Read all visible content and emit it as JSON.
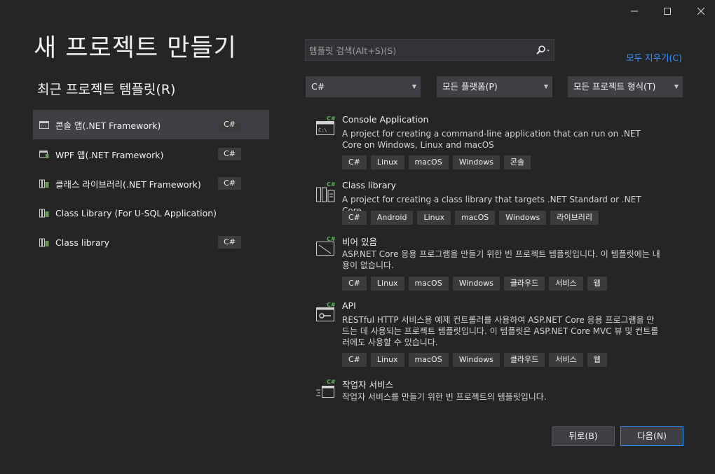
{
  "window": {
    "minimize_icon": "minimize-icon",
    "maximize_icon": "maximize-icon",
    "close_icon": "close-icon"
  },
  "page_title": "새 프로젝트 만들기",
  "recent": {
    "title": "최근 프로젝트 템플릿(R)",
    "items": [
      {
        "label": "콘솔 앱(.NET Framework)",
        "lang": "C#",
        "icon": "console-app-icon",
        "selected": true
      },
      {
        "label": "WPF 앱(.NET Framework)",
        "lang": "C#",
        "icon": "wpf-app-icon"
      },
      {
        "label": "클래스 라이브러리(.NET Framework)",
        "lang": "C#",
        "icon": "class-library-icon"
      },
      {
        "label": "Class Library (For U-SQL Application)",
        "lang": "",
        "icon": "usql-library-icon"
      },
      {
        "label": "Class library",
        "lang": "C#",
        "icon": "class-library-icon"
      }
    ]
  },
  "search": {
    "placeholder": "템플릿 검색(Alt+S)(S)",
    "value": ""
  },
  "clear_all": "모두 지우기(C)",
  "filters": {
    "language": "C#",
    "platform": "모든 플랫폼(P)",
    "project_type": "모든 프로젝트 형식(T)"
  },
  "templates": [
    {
      "name": "Console Application",
      "description": "A project for creating a command-line application that can run on .NET Core on Windows, Linux and macOS",
      "tags": [
        "C#",
        "Linux",
        "macOS",
        "Windows",
        "콘솔"
      ]
    },
    {
      "name": "Class library",
      "description": "A project for creating a class library that targets .NET Standard or .NET Core",
      "tags": [
        "C#",
        "Android",
        "Linux",
        "macOS",
        "Windows",
        "라이브러리"
      ]
    },
    {
      "name": "비어 있음",
      "description": "ASP.NET Core 응용 프로그램을 만들기 위한 빈 프로젝트 템플릿입니다. 이 템플릿에는 내용이 없습니다.",
      "tags": [
        "C#",
        "Linux",
        "macOS",
        "Windows",
        "클라우드",
        "서비스",
        "웹"
      ]
    },
    {
      "name": "API",
      "description": "RESTful HTTP 서비스용 예제 컨트롤러를 사용하여 ASP.NET Core 응용 프로그램을 만드는 데 사용되는 프로젝트 템플릿입니다. 이 템플릿은 ASP.NET Core MVC 뷰 및 컨트롤러에도 사용할 수 있습니다.",
      "tags": [
        "C#",
        "Linux",
        "macOS",
        "Windows",
        "클라우드",
        "서비스",
        "웹"
      ]
    },
    {
      "name": "작업자 서비스",
      "description": "작업자 서비스를 만들기 위한 빈 프로젝트의 템플릿입니다.",
      "tags": []
    }
  ],
  "buttons": {
    "back": "뒤로(B)",
    "next": "다음(N)"
  },
  "colors": {
    "background": "#252526",
    "accent": "#3794ff",
    "csharp_badge": "#5cb85c"
  }
}
